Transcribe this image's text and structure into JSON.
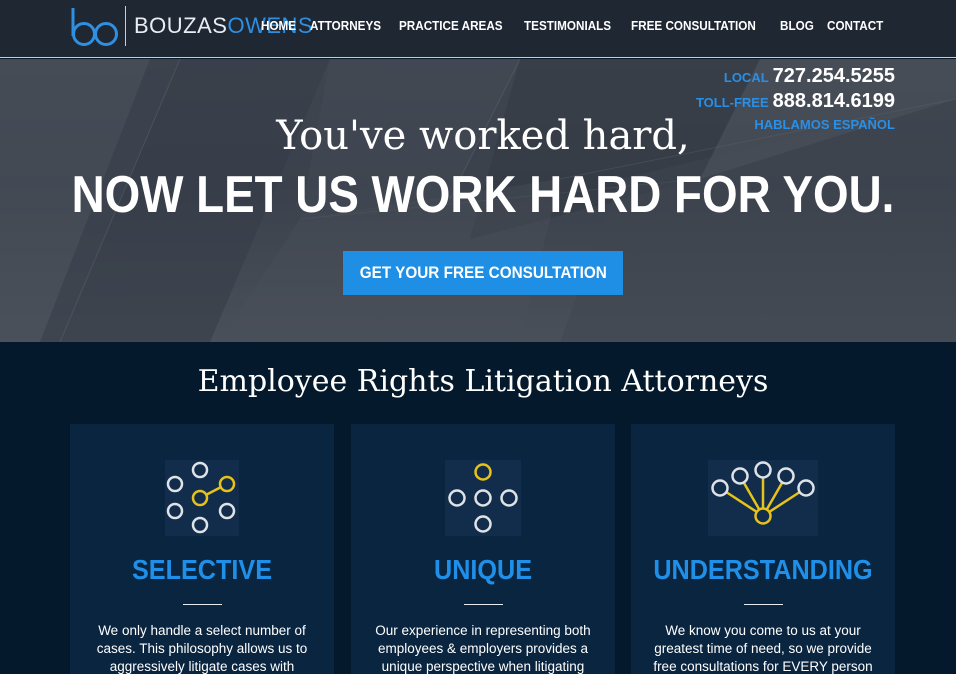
{
  "header": {
    "logo": {
      "word1": "BOUZAS",
      "word2": "OWENS",
      "mark_icon": "bo-monogram-icon"
    },
    "nav": [
      "HOME",
      "ATTORNEYS",
      "PRACTICE AREAS",
      "TESTIMONIALS",
      "FREE CONSULTATION",
      "BLOG",
      "CONTACT"
    ]
  },
  "hero": {
    "phones": {
      "local_label": "LOCAL",
      "local_number": "727.254.5255",
      "tollfree_label": "TOLL-FREE",
      "tollfree_number": "888.814.6199",
      "spanish": "HABLAMOS ESPAÑOL"
    },
    "line1": "You've worked hard,",
    "line2": "NOW LET US WORK HARD FOR YOU.",
    "cta": "GET YOUR FREE CONSULTATION"
  },
  "features": {
    "title": "Employee Rights Litigation Attorneys",
    "cards": [
      {
        "icon": "selective-network-icon",
        "title": "SELECTIVE",
        "text": "We only handle a select number of cases. This philosophy allows us to aggressively litigate cases with"
      },
      {
        "icon": "unique-nodes-icon",
        "title": "UNIQUE",
        "text": "Our experience in representing both employees & employers provides a unique perspective when litigating"
      },
      {
        "icon": "understanding-fan-icon",
        "title": "UNDERSTANDING",
        "text": "We know you come to us at your greatest time of need, so we provide free consultations for EVERY person"
      }
    ]
  },
  "colors": {
    "accent_blue": "#1e8fe5",
    "icon_gold": "#e6c21a",
    "header_bg": "#1f2733",
    "section_bg": "#04192c",
    "card_bg": "#0a2540"
  }
}
